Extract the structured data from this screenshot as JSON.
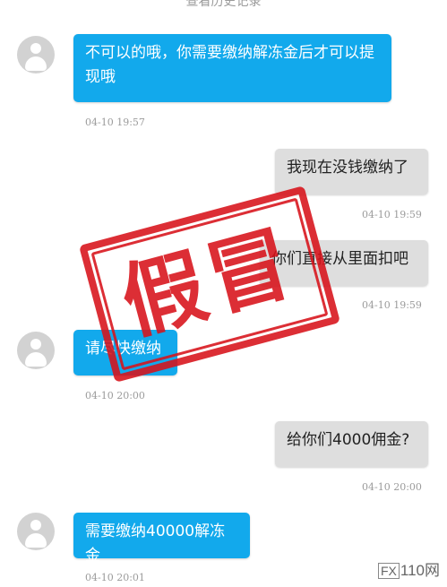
{
  "header": {
    "history_link": "查看历史记录"
  },
  "messages": [
    {
      "side": "in",
      "text": "不可以的哦，你需要缴纳解冻金后才可以提现哦",
      "time": "04-10 19:57"
    },
    {
      "side": "out",
      "text": "我现在没钱缴纳了",
      "time": "04-10 19:59"
    },
    {
      "side": "out",
      "text": "你们直接从里面扣吧",
      "time": "04-10 19:59"
    },
    {
      "side": "in",
      "text": "请尽快缴纳",
      "time": "04-10 20:00"
    },
    {
      "side": "out",
      "text": "给你们4000佣金?",
      "time": "04-10 20:00"
    },
    {
      "side": "in",
      "text": "需要缴纳40000解冻金",
      "time": "04-10 20:01"
    }
  ],
  "stamp": {
    "text": "假冒",
    "color": "#d8121a"
  },
  "watermark": {
    "box": "FX",
    "text": "110网"
  },
  "colors": {
    "incoming_bubble": "#12a9ec",
    "outgoing_bubble": "#dedede"
  }
}
